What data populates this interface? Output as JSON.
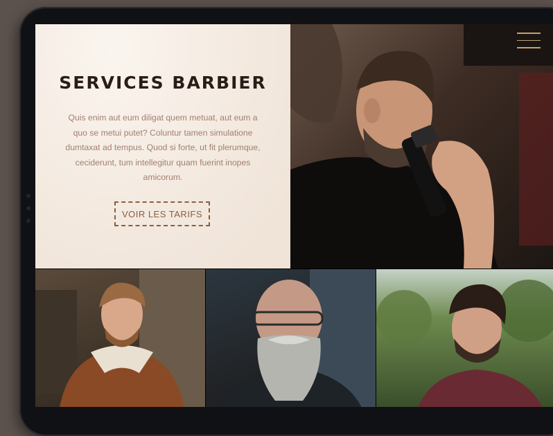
{
  "hero": {
    "title": "SERVICES BARBIER",
    "description": "Quis enim aut eum diligat quem metuat, aut eum a quo se metui putet? Coluntur tamen simulatione dumtaxat ad tempus. Quod si forte, ut fit plerumque, ceciderunt, tum intellegitur quam fuerint inopes amicorum.",
    "cta_label": "VOIR LES TARIFS"
  },
  "colors": {
    "brand_dark": "#2a1d19",
    "text_muted": "#a27f6f",
    "accent": "#8a5e40",
    "menu_accent": "#c9a070",
    "hero_bg": "#f3e9df"
  },
  "icons": {
    "menu": "hamburger-menu-icon"
  }
}
